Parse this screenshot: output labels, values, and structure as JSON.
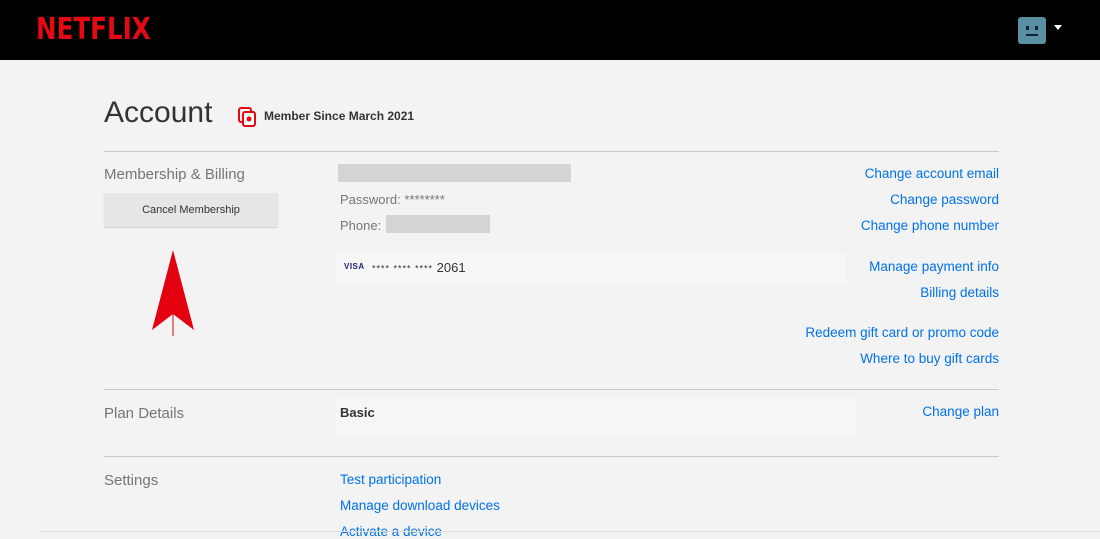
{
  "header": {
    "logo_text": "NETFLIX",
    "brand_color": "#e50914",
    "avatar_icon": "profile-avatar-icon",
    "menu_caret_icon": "caret-down-icon"
  },
  "account": {
    "title": "Account",
    "member_since": "Member Since March 2021",
    "member_since_icon": "membership-badge-icon"
  },
  "membership": {
    "section_label": "Membership & Billing",
    "cancel_button": "Cancel Membership",
    "password_label": "Password:",
    "password_value": "********",
    "phone_label": "Phone:",
    "card_brand": "VISA",
    "card_masked": "**** **** ****",
    "card_last4": "2061",
    "links": [
      "Change account email",
      "Change password",
      "Change phone number",
      "Manage payment info",
      "Billing details",
      "Redeem gift card or promo code",
      "Where to buy gift cards"
    ]
  },
  "plan": {
    "section_label": "Plan Details",
    "value": "Basic",
    "change_link": "Change plan"
  },
  "settings": {
    "section_label": "Settings",
    "links": [
      "Test participation",
      "Manage download devices",
      "Activate a device"
    ]
  },
  "annotation": {
    "arrow_icon": "red-arrow-up-icon",
    "arrow_color": "#e3000f"
  },
  "colors": {
    "link": "#0071eb",
    "background": "#f3f3f3"
  }
}
